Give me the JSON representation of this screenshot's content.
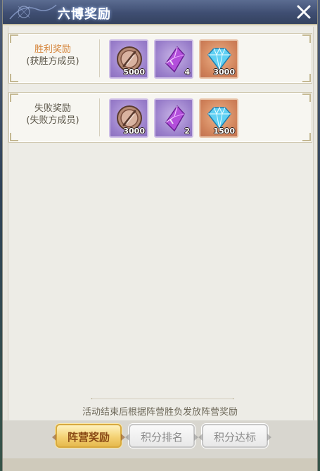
{
  "window": {
    "title": "六博奖励"
  },
  "rewards": [
    {
      "label_line1": "胜利奖励",
      "label_line2": "(获胜方成员)",
      "items": [
        {
          "icon": "bronze-coin-icon",
          "count": "5000",
          "color": "#9a7fcb"
        },
        {
          "icon": "purple-crystal-icon",
          "count": "4",
          "color": "#9a7fcb"
        },
        {
          "icon": "diamond-icon",
          "count": "3000",
          "color": "#d0825a"
        }
      ]
    },
    {
      "label_line1": "失败奖励",
      "label_line2": "(失败方成员)",
      "items": [
        {
          "icon": "bronze-coin-icon",
          "count": "3000",
          "color": "#9a7fcb"
        },
        {
          "icon": "purple-crystal-icon",
          "count": "2",
          "color": "#9a7fcb"
        },
        {
          "icon": "diamond-icon",
          "count": "1500",
          "color": "#d0825a"
        }
      ]
    }
  ],
  "footer": {
    "note": "活动结束后根据阵营胜负发放阵营奖励"
  },
  "tabs": [
    {
      "label": "阵营奖励",
      "active": true
    },
    {
      "label": "积分排名",
      "active": false
    },
    {
      "label": "积分达标",
      "active": false
    }
  ],
  "colors": {
    "win_label": "#d5843a",
    "accent_gold": "#e6b94c",
    "title_bar": "#3f4e72"
  }
}
